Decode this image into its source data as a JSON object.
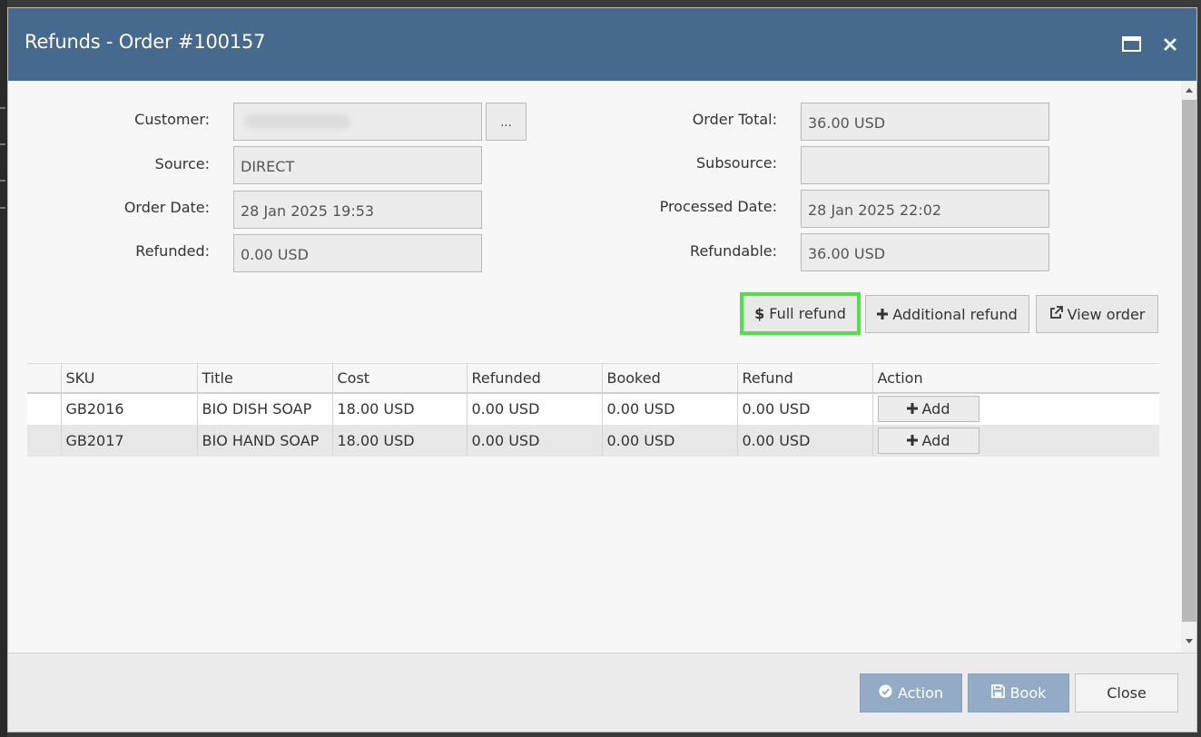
{
  "dialog": {
    "title": "Refunds - Order #100157"
  },
  "form": {
    "left": {
      "customer_label": "Customer:",
      "customer_more_label": "...",
      "source_label": "Source:",
      "source_value": "DIRECT",
      "order_date_label": "Order Date:",
      "order_date_value": "28 Jan 2025 19:53",
      "refunded_label": "Refunded:",
      "refunded_value": "0.00 USD"
    },
    "right": {
      "order_total_label": "Order Total:",
      "order_total_value": "36.00 USD",
      "subsource_label": "Subsource:",
      "subsource_value": "",
      "processed_date_label": "Processed Date:",
      "processed_date_value": "28 Jan 2025 22:02",
      "refundable_label": "Refundable:",
      "refundable_value": "36.00 USD"
    }
  },
  "actions": {
    "full_refund": "Full refund",
    "full_refund_icon": "dollar-icon",
    "additional_refund": "Additional refund",
    "additional_refund_icon": "plus-icon",
    "view_order": "View order",
    "view_order_icon": "external-link-icon",
    "highlight_color": "#52e04a"
  },
  "table": {
    "columns": [
      "",
      "SKU",
      "Title",
      "Cost",
      "Refunded",
      "Booked",
      "Refund",
      "Action"
    ],
    "rows": [
      {
        "sku": "GB2016",
        "title": "BIO DISH SOAP",
        "cost": "18.00 USD",
        "refunded": "0.00 USD",
        "booked": "0.00 USD",
        "refund": "0.00 USD",
        "action": "Add"
      },
      {
        "sku": "GB2017",
        "title": "BIO HAND SOAP",
        "cost": "18.00 USD",
        "refunded": "0.00 USD",
        "booked": "0.00 USD",
        "refund": "0.00 USD",
        "action": "Add"
      }
    ]
  },
  "footer": {
    "action_label": "Action",
    "action_icon": "check-circle-icon",
    "book_label": "Book",
    "book_icon": "save-icon",
    "close_label": "Close"
  },
  "colors": {
    "header": "#46698e",
    "primary_button": "#93abc5"
  }
}
